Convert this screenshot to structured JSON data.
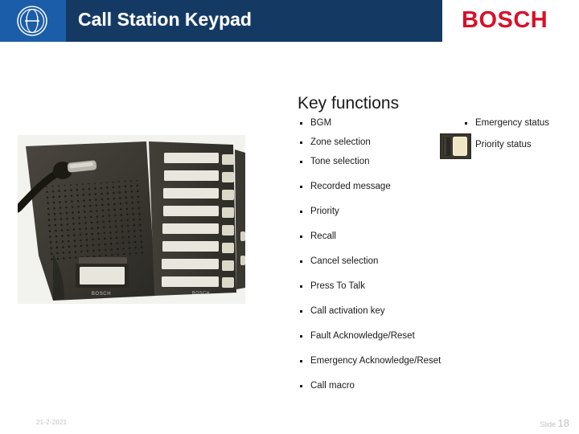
{
  "header": {
    "title": "Call Station Keypad",
    "brand": "BOSCH",
    "logo_icon": "bosch-anchor-symbol",
    "colors": {
      "bar_dark_blue": "#143a64",
      "logo_square_blue": "#1b5da8",
      "brand_red": "#d8102a"
    }
  },
  "content": {
    "heading": "Key functions",
    "left_bullets": [
      "BGM",
      "Zone selection",
      "Tone selection",
      "Recorded message",
      "Priority",
      "Recall",
      "Cancel selection",
      "Press To Talk",
      "Call activation key",
      "Fault Acknowledge/Reset",
      "Emergency Acknowledge/Reset",
      "Call macro"
    ],
    "right_items": [
      {
        "label": "Emergency status",
        "bulleted": true
      },
      {
        "label": "Priority status",
        "bulleted": false
      }
    ],
    "status_icon_name": "keypad-status-led-icon"
  },
  "photo": {
    "alt": "Bosch call station keypad with speaker grille, microphone and selection keys",
    "device_brand": "BOSCH"
  },
  "footer": {
    "date": "21-2-2021",
    "slide_label": "Slide",
    "slide_number": "18"
  }
}
